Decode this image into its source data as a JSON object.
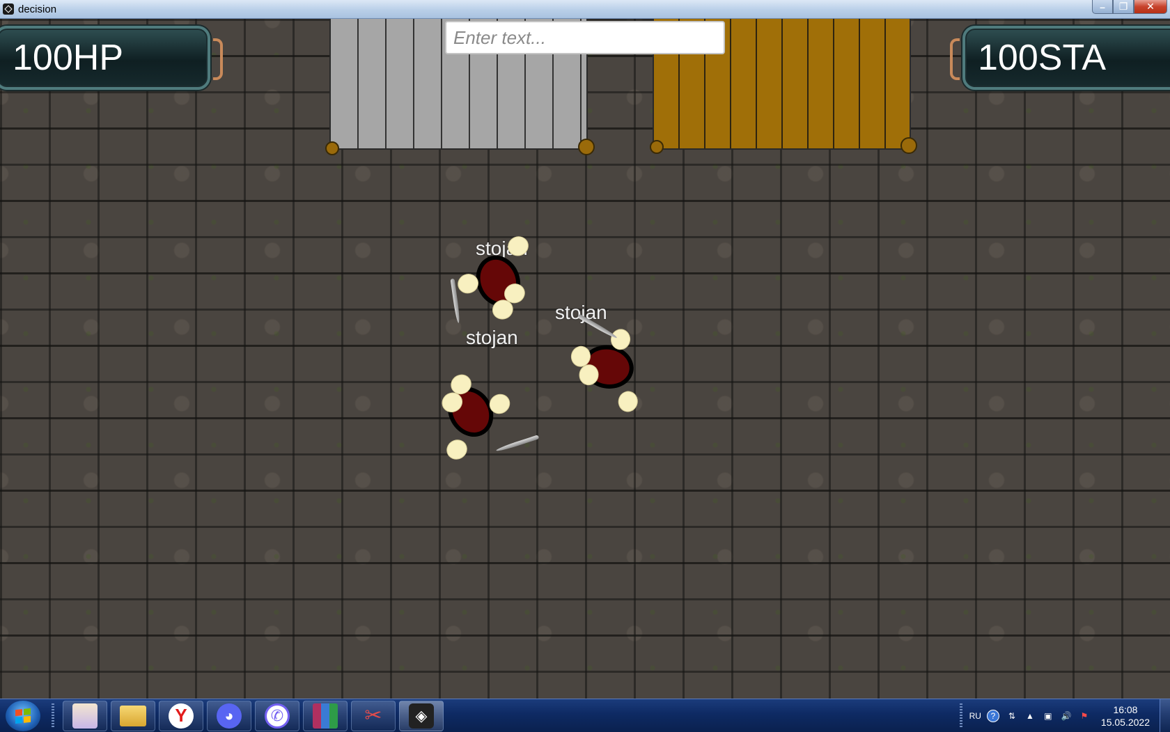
{
  "window": {
    "title": "decision",
    "controls": {
      "minimize": "–",
      "maximize": "❐",
      "close": "✕"
    }
  },
  "hud": {
    "hp": "100HP",
    "stamina": "100STA"
  },
  "chat": {
    "placeholder": "Enter text..."
  },
  "players": [
    {
      "name": "stojan"
    },
    {
      "name": "stojan"
    },
    {
      "name": "stojan"
    }
  ],
  "colors": {
    "body": "#650707",
    "hands": "#f8f0c0",
    "wood": "#a06f08",
    "gray_planks": "#a6a6a6",
    "hud_border": "#4f7b7d",
    "taskbar": "#0e2a63"
  },
  "taskbar": {
    "apps": [
      {
        "name": "anime-app-icon"
      },
      {
        "name": "folder-icon"
      },
      {
        "name": "yandex-icon",
        "glyph": "Y"
      },
      {
        "name": "discord-icon",
        "glyph": "◕"
      },
      {
        "name": "viber-icon",
        "glyph": "✆"
      },
      {
        "name": "winrar-icon",
        "glyph": ""
      },
      {
        "name": "snipping-tool-icon",
        "glyph": "✂"
      },
      {
        "name": "unity-icon",
        "glyph": "◈"
      }
    ],
    "tray": {
      "language": "RU",
      "time": "16:08",
      "date": "15.05.2022"
    }
  }
}
